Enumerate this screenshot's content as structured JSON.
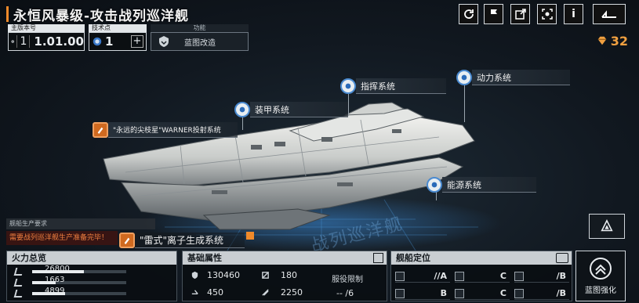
{
  "title": "永恒风暴级-攻击战列巡洋舰",
  "top_buttons": [
    "refresh-icon",
    "flag-icon",
    "share-icon",
    "view-icon",
    "info-icon",
    "back-icon"
  ],
  "info_label": "i",
  "main_version": {
    "label": "主版本号",
    "index": "1",
    "value": "1.01.00"
  },
  "tech_points": {
    "label": "技术点",
    "value": "1",
    "plus": "+"
  },
  "blueprint_mod": {
    "label": "功能",
    "text": "蓝图改造"
  },
  "currency": {
    "value": "32",
    "color": "#f0a040"
  },
  "callouts": {
    "command": "指挥系统",
    "power": "动力系统",
    "armor": "装甲系统",
    "missile": "\"永远的尖枝星\"WARNER投射系统",
    "energy": "能源系统",
    "ion": "\"雷式\"离子生成系统"
  },
  "production": {
    "label": "舰船生产要求",
    "warning": "需要战列巡洋舰生产准备完毕！"
  },
  "watermark": "战列巡洋舰",
  "firepower": {
    "title": "火力总览",
    "rows": [
      {
        "value": "26800",
        "fill": 0.55
      },
      {
        "value": "1663",
        "fill": 0.25
      },
      {
        "value": "4899",
        "fill": 0.35
      }
    ]
  },
  "base_attrs": {
    "title": "基础属性",
    "hp": "130460",
    "armor": "180",
    "speed": "450",
    "shield": "2250",
    "limit_label": "服役限制",
    "limit_value": "-- /6"
  },
  "positioning": {
    "title": "舰船定位",
    "grades": [
      "//A",
      "C",
      "/B",
      "B",
      "C",
      "/B"
    ]
  },
  "upgrade": {
    "label": "蓝图强化"
  },
  "accent": "#f08a2a"
}
